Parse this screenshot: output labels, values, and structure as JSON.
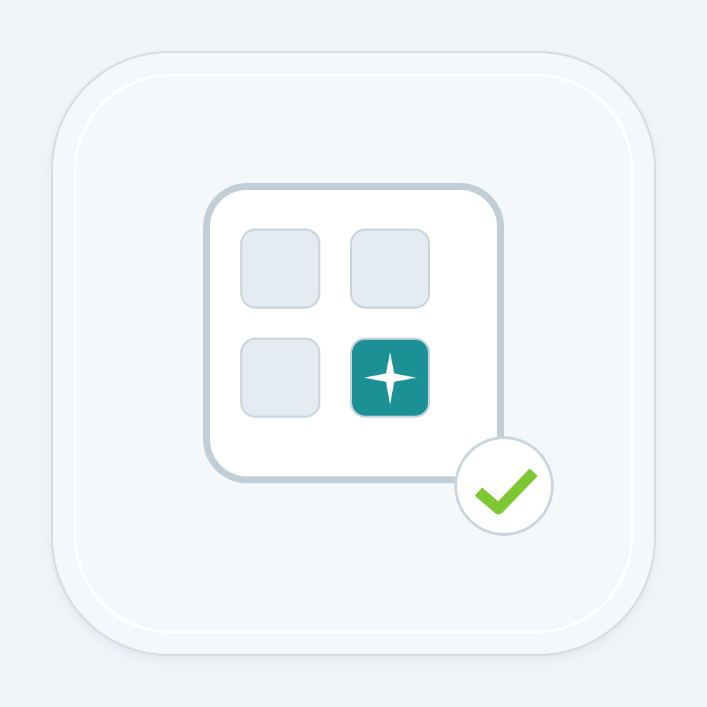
{
  "icon": {
    "name": "app-grid-selection-icon",
    "colors": {
      "background": "#f1f5f8",
      "container_fill": "#f4f8fb",
      "panel_border": "#c1ced6",
      "tile_fill": "#e4ebf2",
      "selected_tile": "#1b9196",
      "sparkle": "#ffffff",
      "check": "#7dc832"
    },
    "tiles": [
      {
        "selected": false
      },
      {
        "selected": false
      },
      {
        "selected": false
      },
      {
        "selected": true,
        "icon": "sparkle-icon"
      }
    ],
    "badge": {
      "icon": "checkmark-icon",
      "state": "verified"
    }
  }
}
